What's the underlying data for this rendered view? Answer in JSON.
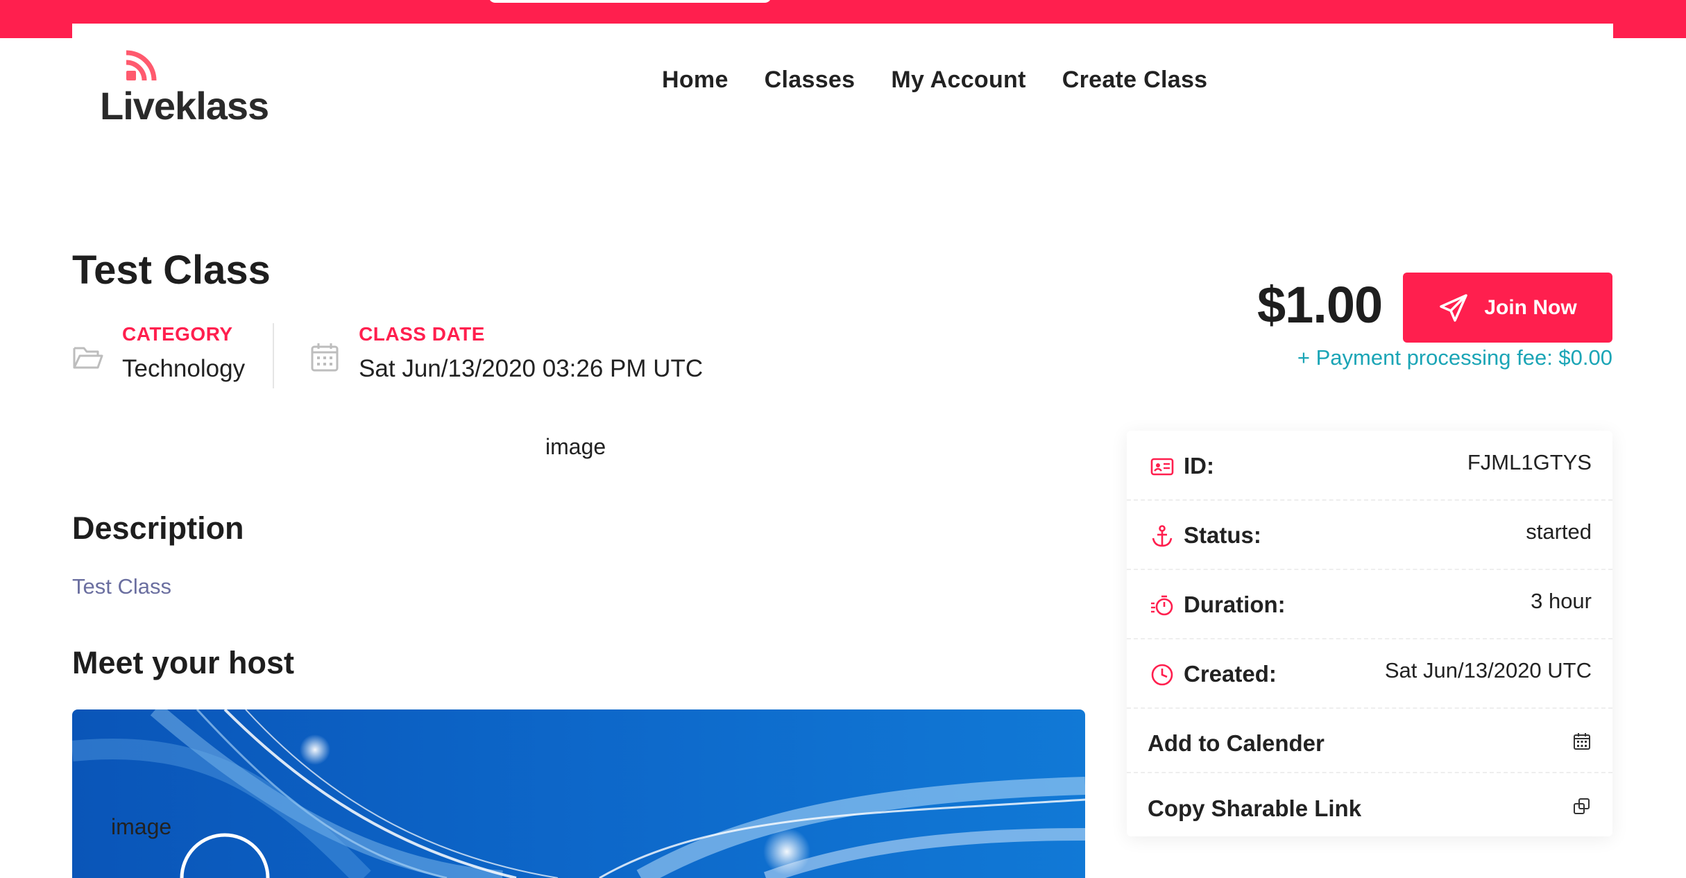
{
  "brand": {
    "name": "Liveklass"
  },
  "nav": [
    "Home",
    "Classes",
    "My Account",
    "Create Class"
  ],
  "class": {
    "title": "Test Class",
    "category_label": "CATEGORY",
    "category_value": "Technology",
    "date_label": "CLASS DATE",
    "date_value": "Sat Jun/13/2020 03:26 PM UTC",
    "image_alt": "image"
  },
  "description": {
    "heading": "Description",
    "text": "Test Class"
  },
  "host": {
    "heading": "Meet your host",
    "image_alt": "image"
  },
  "purchase": {
    "price": "$1.00",
    "join_label": "Join Now",
    "fee_text": "+ Payment processing fee: $0.00"
  },
  "info": {
    "id_label": "ID:",
    "id_value": "FJML1GTYS",
    "status_label": "Status:",
    "status_value": "started",
    "duration_label": "Duration:",
    "duration_value": "3 hour",
    "created_label": "Created:",
    "created_value": "Sat Jun/13/2020 UTC",
    "calendar_label": "Add to Calender",
    "share_label": "Copy Sharable Link"
  },
  "colors": {
    "accent": "#ff1f4e",
    "fee": "#1ba5b6",
    "link": "#6b6fa0"
  }
}
